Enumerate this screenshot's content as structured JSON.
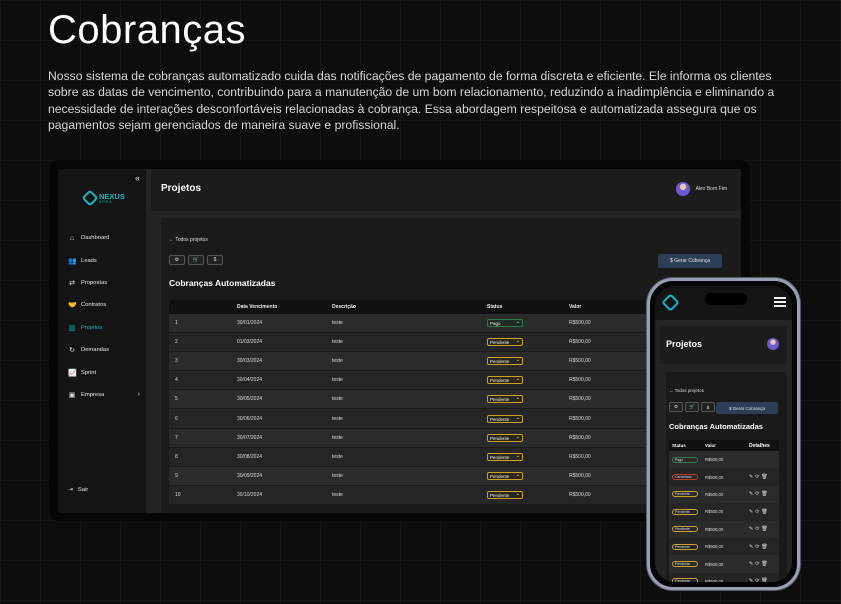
{
  "heading": "Cobranças",
  "description": "Nosso sistema de cobranças automatizado cuida das notificações de pagamento de forma discreta e eficiente. Ele informa os clientes sobre as datas de vencimento, contribuindo para a manutenção de um bom relacionamento, reduzindo a inadimplência e eliminando a necessidade de interações desconfortáveis relacionadas à cobrança. Essa abordagem respeitosa e automatizada assegura que os pagamentos sejam gerenciados de maneira suave e profissional.",
  "app": {
    "logo_text": "NEXUS",
    "logo_sub": "AREA",
    "collapse_icon": "«",
    "nav": [
      {
        "label": "Dashboard",
        "icon": "⌂"
      },
      {
        "label": "Leads",
        "icon": "👥"
      },
      {
        "label": "Propostas",
        "icon": "⇄"
      },
      {
        "label": "Contratos",
        "icon": "🤝"
      },
      {
        "label": "Projetos",
        "icon": "▥"
      },
      {
        "label": "Demandas",
        "icon": "↻"
      },
      {
        "label": "Sprint",
        "icon": "📈"
      },
      {
        "label": "Empresa",
        "icon": "▣"
      }
    ],
    "nav_chevron": "›",
    "logout": "Sair",
    "page_title": "Projetos",
    "user_name": "Alex Born Fim",
    "back_label": "Todos projetos",
    "icon_buttons": [
      "⚙",
      "🛒",
      "$"
    ],
    "generate_button": "Gerar Cobrança",
    "section_title": "Cobranças Automatizadas",
    "table_headers": [
      "",
      "Data Vencimento",
      "Descrição",
      "Status",
      "Valor"
    ],
    "rows": [
      {
        "n": "1",
        "date": "30/01/2024",
        "desc": "teste",
        "status": "Pago",
        "value": "R$500,00"
      },
      {
        "n": "2",
        "date": "01/03/2024",
        "desc": "teste",
        "status": "Pendente",
        "value": "R$500,00"
      },
      {
        "n": "3",
        "date": "30/03/2024",
        "desc": "teste",
        "status": "Pendente",
        "value": "R$500,00"
      },
      {
        "n": "4",
        "date": "30/04/2024",
        "desc": "teste",
        "status": "Pendente",
        "value": "R$500,00"
      },
      {
        "n": "5",
        "date": "30/05/2024",
        "desc": "teste",
        "status": "Pendente",
        "value": "R$500,00"
      },
      {
        "n": "6",
        "date": "30/06/2024",
        "desc": "teste",
        "status": "Pendente",
        "value": "R$500,00"
      },
      {
        "n": "7",
        "date": "30/07/2024",
        "desc": "teste",
        "status": "Pendente",
        "value": "R$500,00"
      },
      {
        "n": "8",
        "date": "30/08/2024",
        "desc": "teste",
        "status": "Pendente",
        "value": "R$500,00"
      },
      {
        "n": "9",
        "date": "30/09/2024",
        "desc": "teste",
        "status": "Pendente",
        "value": "R$500,00"
      },
      {
        "n": "10",
        "date": "30/10/2024",
        "desc": "teste",
        "status": "Pendente",
        "value": "R$500,00"
      }
    ]
  },
  "mobile": {
    "page_title": "Projetos",
    "back_label": "Todos projetos",
    "generate_button": "Gerar Cobrança",
    "section_title": "Cobranças Automatizadas",
    "table_headers": [
      "Status",
      "Valor",
      "Detalhes"
    ],
    "rows": [
      {
        "status": "Pago",
        "value": "R$500,00",
        "kind": "paid",
        "actions": false
      },
      {
        "status": "Cancelado",
        "value": "R$500,00",
        "kind": "canc",
        "actions": true
      },
      {
        "status": "Pendente",
        "value": "R$500,00",
        "kind": "pend",
        "actions": true
      },
      {
        "status": "Pendente",
        "value": "R$500,00",
        "kind": "pend",
        "actions": true
      },
      {
        "status": "Pendente",
        "value": "R$500,00",
        "kind": "pend",
        "actions": true
      },
      {
        "status": "Pendente",
        "value": "R$500,00",
        "kind": "pend",
        "actions": true
      },
      {
        "status": "Pendente",
        "value": "R$500,00",
        "kind": "pend",
        "actions": true
      },
      {
        "status": "Pendente",
        "value": "R$500,00",
        "kind": "pend",
        "actions": true
      }
    ],
    "action_icons": [
      "✎",
      "⟳",
      "🗑"
    ]
  },
  "colors": {
    "accent": "#14b8c6",
    "paid": "#2e7d4f",
    "pending": "#c9a227",
    "cancel": "#c0392b",
    "button": "#2c3e57"
  }
}
